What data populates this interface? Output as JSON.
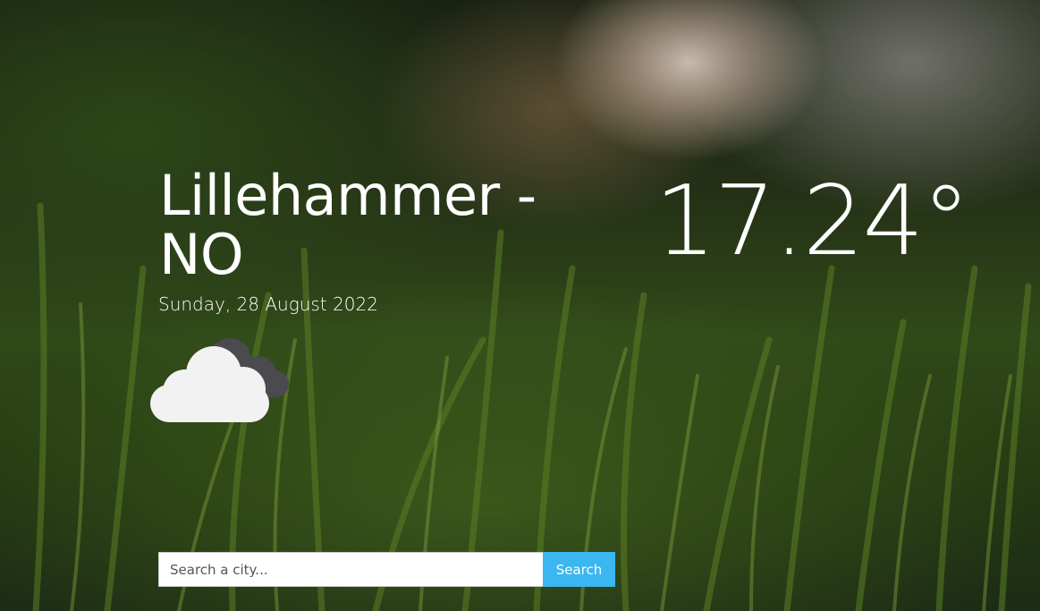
{
  "location": {
    "city_country": "Lillehammer - NO",
    "date": "Sunday, 28 August 2022"
  },
  "weather": {
    "temperature": "17.24°",
    "icon": "cloudy-icon",
    "colors": {
      "cloud_front": "#f2f2f2",
      "cloud_back": "#4a4a4f"
    }
  },
  "search": {
    "placeholder": "Search a city...",
    "value": "",
    "button_label": "Search",
    "button_color": "#3ab7f0"
  }
}
